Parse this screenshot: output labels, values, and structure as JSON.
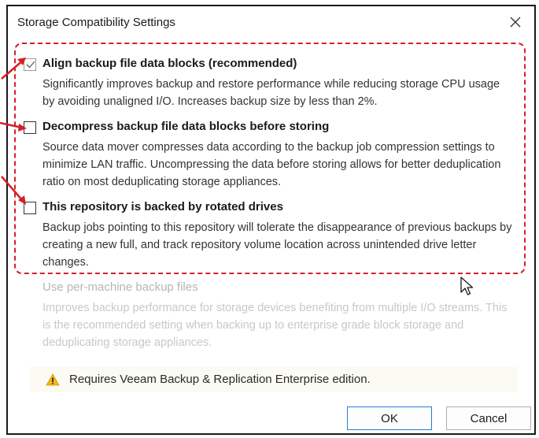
{
  "dialog": {
    "title": "Storage Compatibility Settings",
    "close_label": "×"
  },
  "options": [
    {
      "label": "Align backup file data blocks (recommended)",
      "description": "Significantly improves backup and restore performance while reducing storage CPU usage by avoiding unaligned I/O. Increases backup size by less than 2%.",
      "checked": true,
      "enabled": true
    },
    {
      "label": "Decompress backup file data blocks before storing",
      "description": "Source data mover compresses data according to the backup job compression settings to minimize LAN traffic. Uncompressing the data before storing allows for better deduplication ratio on most deduplicating storage appliances.",
      "checked": false,
      "enabled": true
    },
    {
      "label": "This repository is backed by rotated drives",
      "description": "Backup jobs pointing to this repository will tolerate the disappearance of previous backups by creating a new full, and track repository volume location across unintended drive letter changes.",
      "checked": false,
      "enabled": true
    },
    {
      "label": "Use per-machine backup files",
      "description": "Improves backup performance for storage devices benefiting from multiple I/O streams. This is the recommended setting when backing up to enterprise grade block storage and deduplicating storage appliances.",
      "checked": false,
      "enabled": false
    }
  ],
  "warning": {
    "icon": "warning-icon",
    "text": "Requires Veeam Backup & Replication Enterprise edition."
  },
  "buttons": {
    "ok": "OK",
    "cancel": "Cancel"
  },
  "colors": {
    "annotation_red": "#d61f26",
    "ok_border": "#2b7bd4"
  }
}
